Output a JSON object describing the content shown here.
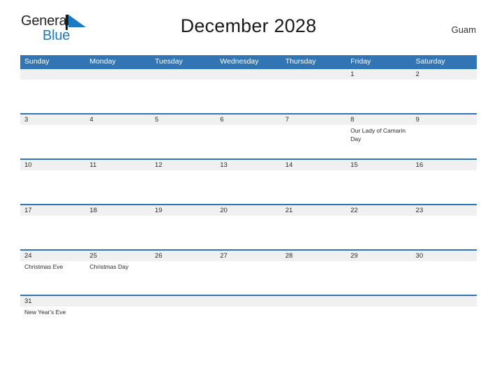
{
  "brand": {
    "name_part1": "General",
    "name_part2": "Blue",
    "flag_icon": "blue-triangle-flag-icon",
    "accent_color": "#1a7bc4"
  },
  "header": {
    "title": "December 2028",
    "location": "Guam"
  },
  "colors": {
    "header_blue": "#3175b5",
    "row_divider_blue": "#2e75b6",
    "number_band_grey": "#f0f0f0",
    "text_dark": "#2b2b2b"
  },
  "calendar": {
    "month": "December",
    "year": "2028",
    "weekday_headers": [
      "Sunday",
      "Monday",
      "Tuesday",
      "Wednesday",
      "Thursday",
      "Friday",
      "Saturday"
    ],
    "weeks": [
      {
        "days": [
          {
            "num": "",
            "event": ""
          },
          {
            "num": "",
            "event": ""
          },
          {
            "num": "",
            "event": ""
          },
          {
            "num": "",
            "event": ""
          },
          {
            "num": "",
            "event": ""
          },
          {
            "num": "1",
            "event": ""
          },
          {
            "num": "2",
            "event": ""
          }
        ]
      },
      {
        "days": [
          {
            "num": "3",
            "event": ""
          },
          {
            "num": "4",
            "event": ""
          },
          {
            "num": "5",
            "event": ""
          },
          {
            "num": "6",
            "event": ""
          },
          {
            "num": "7",
            "event": ""
          },
          {
            "num": "8",
            "event": "Our Lady of Camarin Day"
          },
          {
            "num": "9",
            "event": ""
          }
        ]
      },
      {
        "days": [
          {
            "num": "10",
            "event": ""
          },
          {
            "num": "11",
            "event": ""
          },
          {
            "num": "12",
            "event": ""
          },
          {
            "num": "13",
            "event": ""
          },
          {
            "num": "14",
            "event": ""
          },
          {
            "num": "15",
            "event": ""
          },
          {
            "num": "16",
            "event": ""
          }
        ]
      },
      {
        "days": [
          {
            "num": "17",
            "event": ""
          },
          {
            "num": "18",
            "event": ""
          },
          {
            "num": "19",
            "event": ""
          },
          {
            "num": "20",
            "event": ""
          },
          {
            "num": "21",
            "event": ""
          },
          {
            "num": "22",
            "event": ""
          },
          {
            "num": "23",
            "event": ""
          }
        ]
      },
      {
        "days": [
          {
            "num": "24",
            "event": "Christmas Eve"
          },
          {
            "num": "25",
            "event": "Christmas Day"
          },
          {
            "num": "26",
            "event": ""
          },
          {
            "num": "27",
            "event": ""
          },
          {
            "num": "28",
            "event": ""
          },
          {
            "num": "29",
            "event": ""
          },
          {
            "num": "30",
            "event": ""
          }
        ]
      },
      {
        "days": [
          {
            "num": "31",
            "event": "New Year's Eve"
          },
          {
            "num": "",
            "event": ""
          },
          {
            "num": "",
            "event": ""
          },
          {
            "num": "",
            "event": ""
          },
          {
            "num": "",
            "event": ""
          },
          {
            "num": "",
            "event": ""
          },
          {
            "num": "",
            "event": ""
          }
        ]
      }
    ]
  }
}
